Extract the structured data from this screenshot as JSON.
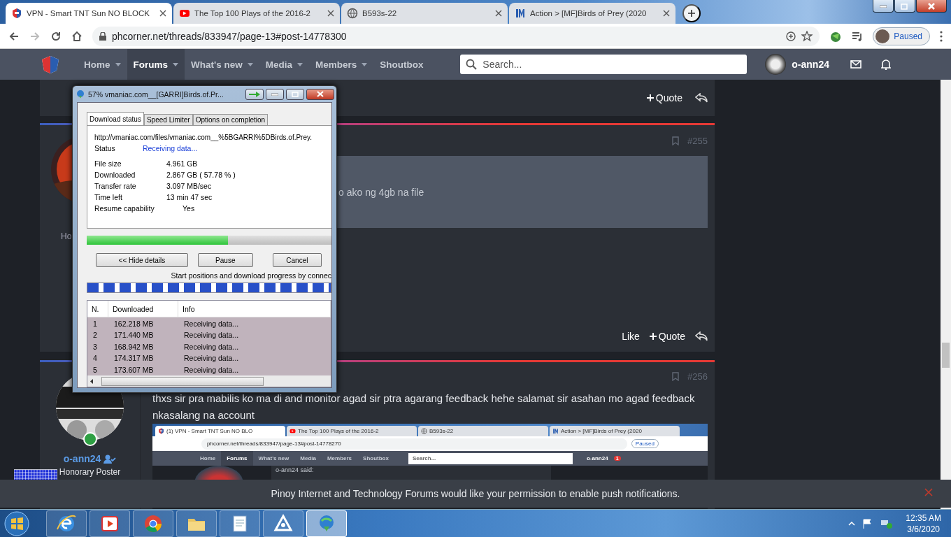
{
  "browser": {
    "tabs": [
      {
        "title": "VPN - Smart TNT Sun NO BLOCK",
        "kind": "shield",
        "selected": true
      },
      {
        "title": "The Top 100 Plays of the 2016-2",
        "kind": "video",
        "selected": false
      },
      {
        "title": "B593s-22",
        "kind": "globe",
        "selected": false
      },
      {
        "title": "Action > [MF]Birds of Prey (2020",
        "kind": "bars",
        "selected": false
      }
    ],
    "address": "phcorner.net/threads/833947/page-13#post-14778300",
    "profile": "Paused"
  },
  "forum_nav": {
    "items": [
      {
        "label": "Home",
        "has_menu": true,
        "selected": false
      },
      {
        "label": "Forums",
        "has_menu": true,
        "selected": true
      },
      {
        "label": "What's new",
        "has_menu": true,
        "selected": false
      },
      {
        "label": "Media",
        "has_menu": true,
        "selected": false
      },
      {
        "label": "Members",
        "has_menu": true,
        "selected": false
      },
      {
        "label": "Shoutbox",
        "has_menu": false,
        "selected": false
      }
    ],
    "search": {
      "placeholder": "Search..."
    },
    "username": "o-ann24"
  },
  "top_post": {
    "actions": [
      "Quote"
    ]
  },
  "post_255": {
    "number": "#255",
    "author_fragment": "Ho",
    "quote_text": "o ako ng 4gb na file",
    "actions": [
      "Like",
      "Quote"
    ]
  },
  "post_256": {
    "number": "#256",
    "author": "o-ann24",
    "role": "Honorary Poster",
    "online": true,
    "text": "thxs sir pra mabilis ko ma di and monitor agad sir ptra agarang feedback hehe salamat sir asahan mo agad feedback nkasalang na account",
    "screenshot": {
      "tabs": [
        {
          "title": "(1) VPN - Smart TNT Sun NO BLO",
          "kind": "shield",
          "selected": true
        },
        {
          "title": "The Top 100 Plays of the 2016-2",
          "kind": "video",
          "selected": false
        },
        {
          "title": "B593s-22",
          "kind": "globe",
          "selected": false
        },
        {
          "title": "Action > [MF]Birds of Prey (2020",
          "kind": "bars",
          "selected": false
        }
      ],
      "address": "phcorner.net/threads/833947/page-13#post-14778270",
      "profile": "Paused",
      "nav": [
        {
          "label": "Home",
          "selected": false
        },
        {
          "label": "Forums",
          "selected": true
        },
        {
          "label": "What's new",
          "selected": false
        },
        {
          "label": "Media",
          "selected": false
        },
        {
          "label": "Members",
          "selected": false
        },
        {
          "label": "Shoutbox",
          "selected": false
        }
      ],
      "search_placeholder": "Search...",
      "username": "o-ann24",
      "notification_count": "1",
      "quote_author": "o-ann24 said:"
    }
  },
  "download_dialog": {
    "title": "57% vmaniac.com__[GARRI]Birds.of.Pr...",
    "tabs": [
      {
        "label": "Download status",
        "selected": true
      },
      {
        "label": "Speed Limiter",
        "selected": false
      },
      {
        "label": "Options on completion",
        "selected": false
      }
    ],
    "url": "http://vmaniac.com/files/vmaniac.com__%5BGARRI%5DBirds.of.Prey.",
    "status": {
      "label": "Status",
      "value": "Receiving data..."
    },
    "fields": [
      {
        "label": "File size",
        "value": "4.961  GB"
      },
      {
        "label": "Downloaded",
        "value": "2.867  GB  ( 57.78 % )"
      },
      {
        "label": "Transfer rate",
        "value": "3.097  MB/sec"
      },
      {
        "label": "Time left",
        "value": "13 min 47 sec"
      },
      {
        "label": "Resume capability",
        "value": "Yes"
      }
    ],
    "level": 0.5778,
    "buttons": [
      "<< Hide details",
      "Pause",
      "Cancel"
    ],
    "connections_caption": "Start positions and download progress by connec",
    "columns": [
      "N.",
      "Downloaded",
      "Info"
    ],
    "rows": [
      {
        "n": "1",
        "downloaded": "162.218  MB",
        "info": "Receiving data..."
      },
      {
        "n": "2",
        "downloaded": "171.440  MB",
        "info": "Receiving data..."
      },
      {
        "n": "3",
        "downloaded": "168.942  MB",
        "info": "Receiving data..."
      },
      {
        "n": "4",
        "downloaded": "174.317  MB",
        "info": "Receiving data..."
      },
      {
        "n": "5",
        "downloaded": "173.607  MB",
        "info": "Receiving data..."
      }
    ]
  },
  "push_notice": {
    "text": "Pinoy Internet and Technology Forums would like your permission to enable push notifications."
  },
  "taskbar": {
    "apps": [
      {
        "kind": "ie",
        "selected": false
      },
      {
        "kind": "media",
        "selected": false
      },
      {
        "kind": "chrome",
        "selected": false
      },
      {
        "kind": "folder",
        "selected": false
      },
      {
        "kind": "notepad",
        "selected": false
      },
      {
        "kind": "triangle",
        "selected": false
      },
      {
        "kind": "idm",
        "selected": true
      }
    ],
    "time": "12:35 AM",
    "date": "3/6/2020"
  }
}
